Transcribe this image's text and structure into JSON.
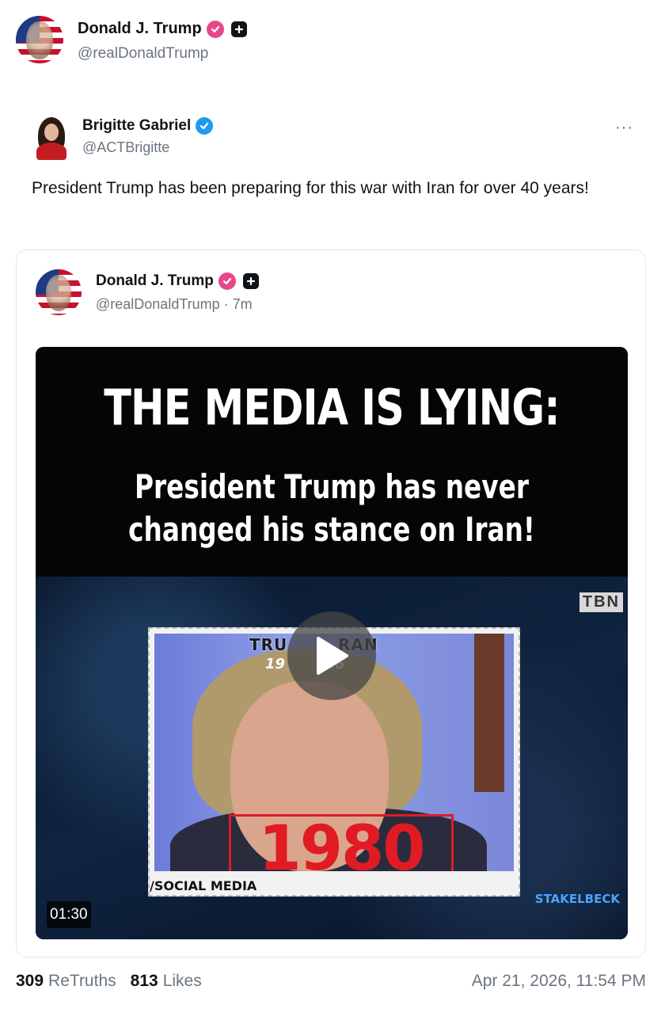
{
  "post": {
    "author": {
      "name": "Donald J. Trump",
      "handle": "@realDonaldTrump"
    },
    "quoted": {
      "author": {
        "name": "Brigitte Gabriel",
        "handle": "@ACTBrigitte"
      },
      "more_label": "···",
      "text": "President Trump has been preparing for this war with Iran for over 40 years!",
      "embedded": {
        "author": {
          "name": "Donald J. Trump",
          "handle": "@realDonaldTrump · 7m"
        },
        "video": {
          "headline": "THE MEDIA IS LYING:",
          "subhead_line1": "President Trump has never",
          "subhead_line2": "changed his stance on Iran!",
          "network_bug": "TBN",
          "inset_title": "TRU        RAN",
          "inset_years": "19        26",
          "year": "1980",
          "caption": "/SOCIAL MEDIA",
          "watermark": "STAKELBECK",
          "duration": "01:30"
        }
      }
    },
    "stats": {
      "retruths_count": "309",
      "retruths_label": "ReTruths",
      "likes_count": "813",
      "likes_label": "Likes",
      "timestamp": "Apr 21, 2026, 11:54 PM"
    }
  },
  "colors": {
    "verified_pink": "#e8488a",
    "verified_blue": "#1d9bf0",
    "text_primary": "#0f1419",
    "text_secondary": "#6b7580",
    "accent_red": "#e01b24"
  },
  "icons": [
    "verified-badge-icon",
    "plus-badge-icon",
    "more-icon",
    "play-icon"
  ]
}
